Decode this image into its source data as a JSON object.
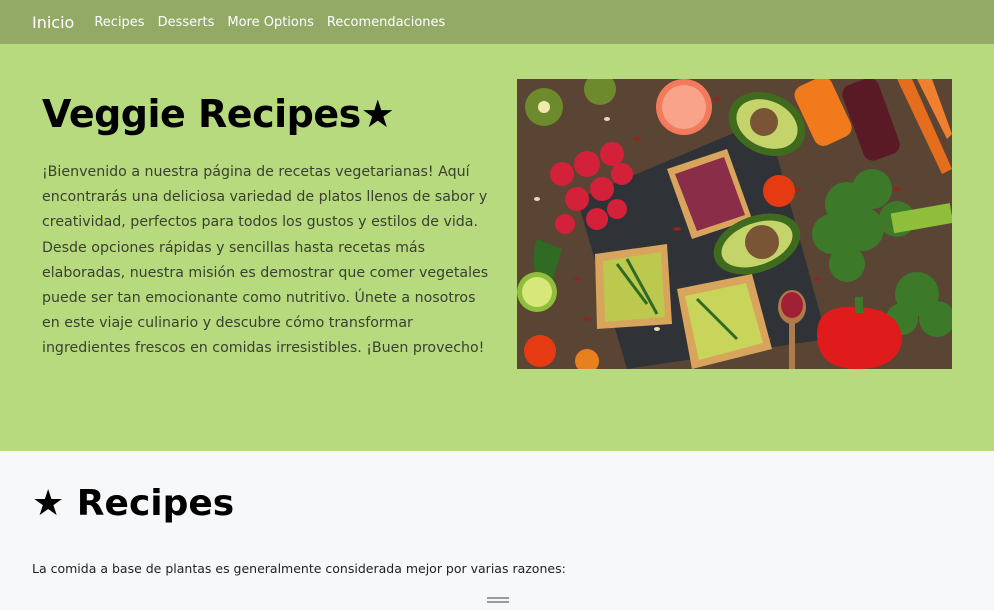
{
  "navbar": {
    "brand": "Inicio",
    "links": [
      "Recipes",
      "Desserts",
      "More Options",
      "Recomendaciones"
    ],
    "background": "#93a966"
  },
  "hero": {
    "title": "Veggie Recipes★",
    "text": "¡Bienvenido a nuestra página de recetas vegetarianas! Aquí encontrarás una deliciosa variedad de platos llenos de sabor y creatividad, perfectos para todos los gustos y estilos de vida. Desde opciones rápidas y sencillas hasta recetas más elaboradas, nuestra misión es demostrar que comer vegetales puede ser tan emocionante como nutritivo. Únete a nosotros en este viaje culinario y descubre cómo transformar ingredientes frescos en comidas irresistibles. ¡Buen provecho!",
    "background": "#b7da7e"
  },
  "section": {
    "title": "★ Recipes",
    "text": "La comida a base de plantas es generalmente considerada mejor por varias razones:"
  }
}
